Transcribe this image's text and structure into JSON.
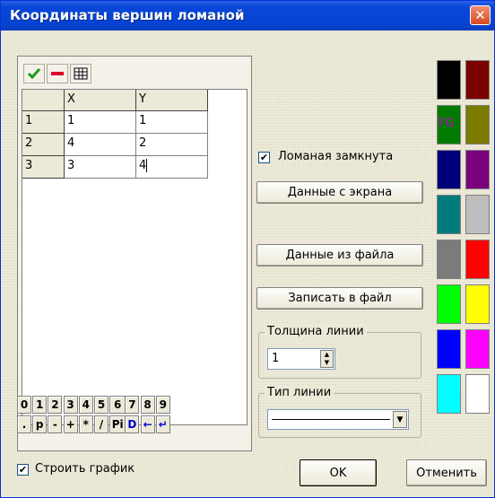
{
  "window": {
    "title": "Координаты вершин ломаной",
    "close_glyph": "✕"
  },
  "table": {
    "columns": [
      "X",
      "Y"
    ],
    "rows": [
      {
        "n": "1",
        "x": "1",
        "y": "1"
      },
      {
        "n": "2",
        "x": "4",
        "y": "2"
      },
      {
        "n": "3",
        "x": "3",
        "y": "4"
      }
    ]
  },
  "toolbar": {
    "icons": [
      "checkmark-icon",
      "minus-icon",
      "grid-icon"
    ]
  },
  "keypad": {
    "row1": [
      "0",
      "1",
      "2",
      "3",
      "4",
      "5",
      "6",
      "7",
      "8",
      "9"
    ],
    "row2": [
      ".",
      "p",
      "-",
      "+",
      "*",
      "/",
      "Pi",
      "D",
      "←",
      "↵"
    ]
  },
  "controls": {
    "closed_label": "Ломаная замкнута",
    "closed_checked": true,
    "from_screen": "Данные с экрана",
    "from_file": "Данные из файла",
    "to_file": "Записать в файл",
    "thickness_label": "Толщина линии",
    "thickness_value": "1",
    "linetype_label": "Тип линии",
    "plot_label": "Строить график",
    "plot_checked": true,
    "ok": "OK",
    "cancel": "Отменить",
    "check_glyph": "✔"
  },
  "palette": {
    "fg_label": "FG",
    "colors": [
      [
        "#000000",
        "#7b0000"
      ],
      [
        "#007b00",
        "#7b7b00"
      ],
      [
        "#00007b",
        "#7b007b"
      ],
      [
        "#007b7b",
        "#bdbdbd"
      ],
      [
        "#7b7b7b",
        "#ff0000"
      ],
      [
        "#00ff00",
        "#ffff00"
      ],
      [
        "#0000ff",
        "#ff00ff"
      ],
      [
        "#00ffff",
        "#ffffff"
      ]
    ]
  }
}
